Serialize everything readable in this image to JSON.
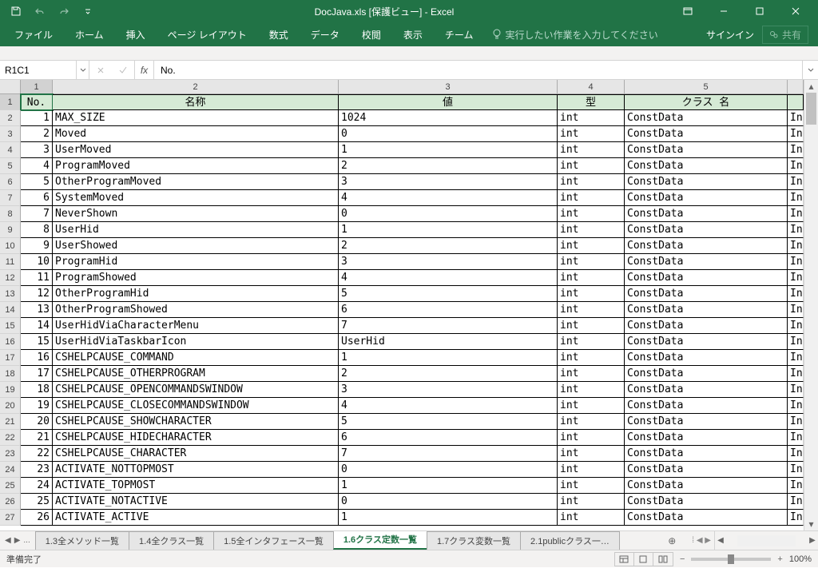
{
  "window": {
    "title": "DocJava.xls  [保護ビュー] - Excel",
    "signin": "サインイン",
    "share": "共有"
  },
  "ribbon": {
    "tabs": [
      "ファイル",
      "ホーム",
      "挿入",
      "ページ レイアウト",
      "数式",
      "データ",
      "校閲",
      "表示",
      "チーム"
    ],
    "tellme": "実行したい作業を入力してください"
  },
  "namebox": "R1C1",
  "formula": "No.",
  "columns": [
    "1",
    "2",
    "3",
    "4",
    "5"
  ],
  "headers": {
    "no": "No.",
    "name": "名称",
    "value": "値",
    "type": "型",
    "class": "クラス 名"
  },
  "rows": [
    {
      "n": "1",
      "name": "MAX_SIZE",
      "val": "1024",
      "type": "int",
      "cls": "ConstData",
      "x": "In"
    },
    {
      "n": "2",
      "name": "Moved",
      "val": "0",
      "type": "int",
      "cls": "ConstData",
      "x": "In"
    },
    {
      "n": "3",
      "name": "UserMoved",
      "val": "1",
      "type": "int",
      "cls": "ConstData",
      "x": "In"
    },
    {
      "n": "4",
      "name": "ProgramMoved",
      "val": "2",
      "type": "int",
      "cls": "ConstData",
      "x": "In"
    },
    {
      "n": "5",
      "name": "OtherProgramMoved",
      "val": "3",
      "type": "int",
      "cls": "ConstData",
      "x": "In"
    },
    {
      "n": "6",
      "name": "SystemMoved",
      "val": "4",
      "type": "int",
      "cls": "ConstData",
      "x": "In"
    },
    {
      "n": "7",
      "name": "NeverShown",
      "val": "0",
      "type": "int",
      "cls": "ConstData",
      "x": "In"
    },
    {
      "n": "8",
      "name": "UserHid",
      "val": "1",
      "type": "int",
      "cls": "ConstData",
      "x": "In"
    },
    {
      "n": "9",
      "name": "UserShowed",
      "val": "2",
      "type": "int",
      "cls": "ConstData",
      "x": "In"
    },
    {
      "n": "10",
      "name": "ProgramHid",
      "val": "3",
      "type": "int",
      "cls": "ConstData",
      "x": "In"
    },
    {
      "n": "11",
      "name": "ProgramShowed",
      "val": "4",
      "type": "int",
      "cls": "ConstData",
      "x": "In"
    },
    {
      "n": "12",
      "name": "OtherProgramHid",
      "val": "5",
      "type": "int",
      "cls": "ConstData",
      "x": "In"
    },
    {
      "n": "13",
      "name": "OtherProgramShowed",
      "val": "6",
      "type": "int",
      "cls": "ConstData",
      "x": "In"
    },
    {
      "n": "14",
      "name": "UserHidViaCharacterMenu",
      "val": "7",
      "type": "int",
      "cls": "ConstData",
      "x": "In"
    },
    {
      "n": "15",
      "name": "UserHidViaTaskbarIcon",
      "val": "UserHid",
      "type": "int",
      "cls": "ConstData",
      "x": "In"
    },
    {
      "n": "16",
      "name": "CSHELPCAUSE_COMMAND",
      "val": "1",
      "type": "int",
      "cls": "ConstData",
      "x": "In"
    },
    {
      "n": "17",
      "name": "CSHELPCAUSE_OTHERPROGRAM",
      "val": "2",
      "type": "int",
      "cls": "ConstData",
      "x": "In"
    },
    {
      "n": "18",
      "name": "CSHELPCAUSE_OPENCOMMANDSWINDOW",
      "val": "3",
      "type": "int",
      "cls": "ConstData",
      "x": "In"
    },
    {
      "n": "19",
      "name": "CSHELPCAUSE_CLOSECOMMANDSWINDOW",
      "val": "4",
      "type": "int",
      "cls": "ConstData",
      "x": "In"
    },
    {
      "n": "20",
      "name": "CSHELPCAUSE_SHOWCHARACTER",
      "val": "5",
      "type": "int",
      "cls": "ConstData",
      "x": "In"
    },
    {
      "n": "21",
      "name": "CSHELPCAUSE_HIDECHARACTER",
      "val": "6",
      "type": "int",
      "cls": "ConstData",
      "x": "In"
    },
    {
      "n": "22",
      "name": "CSHELPCAUSE_CHARACTER",
      "val": "7",
      "type": "int",
      "cls": "ConstData",
      "x": "In"
    },
    {
      "n": "23",
      "name": "ACTIVATE_NOTTOPMOST",
      "val": "0",
      "type": "int",
      "cls": "ConstData",
      "x": "In"
    },
    {
      "n": "24",
      "name": "ACTIVATE_TOPMOST",
      "val": "1",
      "type": "int",
      "cls": "ConstData",
      "x": "In"
    },
    {
      "n": "25",
      "name": "ACTIVATE_NOTACTIVE",
      "val": "0",
      "type": "int",
      "cls": "ConstData",
      "x": "In"
    },
    {
      "n": "26",
      "name": "ACTIVATE_ACTIVE",
      "val": "1",
      "type": "int",
      "cls": "ConstData",
      "x": "In"
    }
  ],
  "sheets": {
    "hidden_indicator": "...",
    "tabs": [
      {
        "label": "1.3全メソッド一覧",
        "active": false
      },
      {
        "label": "1.4全クラス一覧",
        "active": false
      },
      {
        "label": "1.5全インタフェース一覧",
        "active": false
      },
      {
        "label": "1.6クラス定数一覧",
        "active": true
      },
      {
        "label": "1.7クラス変数一覧",
        "active": false
      },
      {
        "label": "2.1publicクラス一…",
        "active": false
      }
    ]
  },
  "status": {
    "ready": "準備完了",
    "zoom": "100%"
  }
}
